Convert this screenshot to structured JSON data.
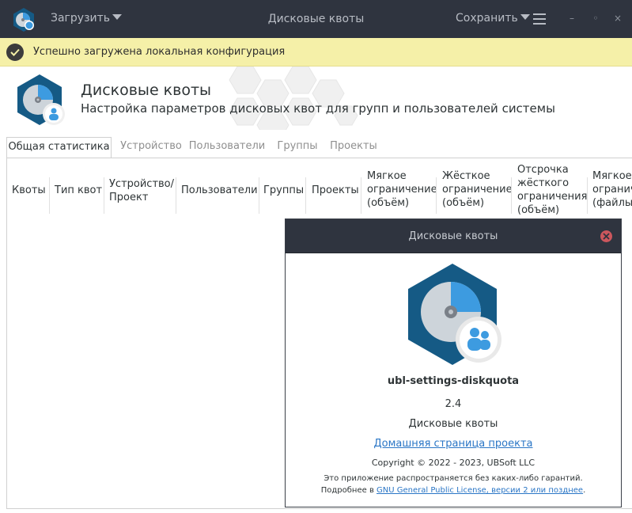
{
  "titlebar": {
    "load_label": "Загрузить",
    "title": "Дисковые квоты",
    "save_label": "Сохранить",
    "minimize": "–",
    "maximize": "◦",
    "close": "×"
  },
  "banner": {
    "message": "Успешно загружена локальная конфигурация",
    "color": "#f5f0a8"
  },
  "header": {
    "title": "Дисковые квоты",
    "subtitle": "Настройка параметров дисковых квот для групп и пользователей системы"
  },
  "tabs": [
    {
      "label": "Общая статистика",
      "active": true
    },
    {
      "label": "Устройство",
      "active": false
    },
    {
      "label": "Пользователи",
      "active": false
    },
    {
      "label": "Группы",
      "active": false
    },
    {
      "label": "Проекты",
      "active": false
    }
  ],
  "table": {
    "columns": [
      "Квоты",
      "Тип квот",
      "Устройство/\nПроект",
      "Пользователи",
      "Группы",
      "Проекты",
      "Мягкое\nограничение\n(объём)",
      "Жёсткое\nограничение\n(объём)",
      "Отсрочка\nжёсткого\nограничения\n(объём)",
      "Мягкое\nограничение\n(файлы)"
    ]
  },
  "about": {
    "title": "Дисковые квоты",
    "program_name": "ubl-settings-diskquota",
    "version": "2.4",
    "description": "Дисковые квоты",
    "website_label": "Домашняя страница проекта",
    "copyright": "Copyright © 2022 - 2023, UBSoft LLC",
    "warranty_line1": "Это приложение распространяется без каких-либо гарантий.",
    "warranty_prefix": "Подробнее в ",
    "license_link": "GNU General Public License, версии 2 или позднее",
    "warranty_suffix": "."
  },
  "colors": {
    "titlebar_bg": "#2f343f",
    "logo_hex": "#155a85",
    "accent_blue": "#2a76c6",
    "close_red": "#cc575d"
  },
  "icons": {
    "app": "diskquota-logo-icon",
    "banner": "check-circle-icon",
    "menu": "hamburger-menu-icon",
    "close_dialog": "close-icon"
  }
}
